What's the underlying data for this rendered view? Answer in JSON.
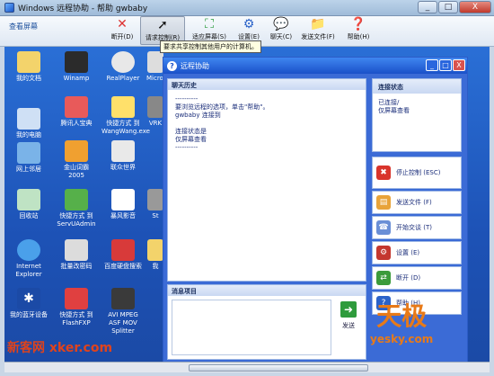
{
  "window": {
    "title": "Windows 远程协助 - 帮助 gwbaby",
    "min": "_",
    "max": "□",
    "close": "X"
  },
  "toolbar": {
    "view_screen": "查看屏幕",
    "buttons": [
      {
        "label": "断开(D)",
        "icon": "close-x-icon"
      },
      {
        "label": "请求控制(R)",
        "icon": "cursor-icon"
      },
      {
        "label": "适应屏幕(S)",
        "icon": "fit-screen-icon"
      },
      {
        "label": "设置(E)",
        "icon": "settings-icon"
      },
      {
        "label": "聊天(C)",
        "icon": "chat-icon"
      },
      {
        "label": "发送文件(F)",
        "icon": "send-file-icon"
      },
      {
        "label": "帮助(H)",
        "icon": "help-icon"
      }
    ],
    "tooltip": "要求共享控制其他用户的计算机。"
  },
  "desktop_icons": [
    {
      "label": "我的文档"
    },
    {
      "label": "Winamp"
    },
    {
      "label": "RealPlayer"
    },
    {
      "label": "我的电脑"
    },
    {
      "label": "腾讯人宝典"
    },
    {
      "label": "快捷方式 到 WangWang.exe"
    },
    {
      "label": "网上邻居"
    },
    {
      "label": "金山词霸 2005"
    },
    {
      "label": "联众世界"
    },
    {
      "label": "回收站"
    },
    {
      "label": "快捷方式 到 ServUAdmin"
    },
    {
      "label": "暴风影音"
    },
    {
      "label": "Internet Explorer"
    },
    {
      "label": "批量改密码"
    },
    {
      "label": "百度硬盘搜索"
    },
    {
      "label": "我的蓝牙设备"
    },
    {
      "label": "快捷方式 到 FlashFXP"
    },
    {
      "label": "AVI MPEG ASF MOV Splitter"
    }
  ],
  "partial_icons": [
    "MicroFi",
    "VRK",
    "St",
    "我"
  ],
  "assist": {
    "title": "远程协助",
    "chat_header": "聊天历史",
    "chat_log": [
      "----------",
      "要浏览远程的选项，单击\"帮助\"。",
      "gwbaby 连接到",
      "",
      "连接状态是",
      "仅屏幕查看",
      "----------"
    ],
    "message_header": "消息项目",
    "send_label": "发送",
    "status_header": "连接状态",
    "status_lines": [
      "已连接/",
      "仅屏幕查看"
    ],
    "actions": [
      {
        "label": "停止控制 (ESC)",
        "icon": "stop-icon",
        "color": "#d9342b"
      },
      {
        "label": "发送文件 (F)",
        "icon": "send-file-icon",
        "color": "#e8a33a"
      },
      {
        "label": "开始交谈 (T)",
        "icon": "talk-icon",
        "color": "#6a8fd6"
      },
      {
        "label": "设置 (E)",
        "icon": "settings-icon",
        "color": "#c4372f"
      },
      {
        "label": "断开 (D)",
        "icon": "disconnect-icon",
        "color": "#3b9b3b"
      },
      {
        "label": "帮助 (H)",
        "icon": "help-icon",
        "color": "#2b62c9"
      }
    ]
  },
  "watermarks": {
    "left": "新客网 xker.com",
    "right_big": "天极",
    "right_small": "yesky.com"
  }
}
